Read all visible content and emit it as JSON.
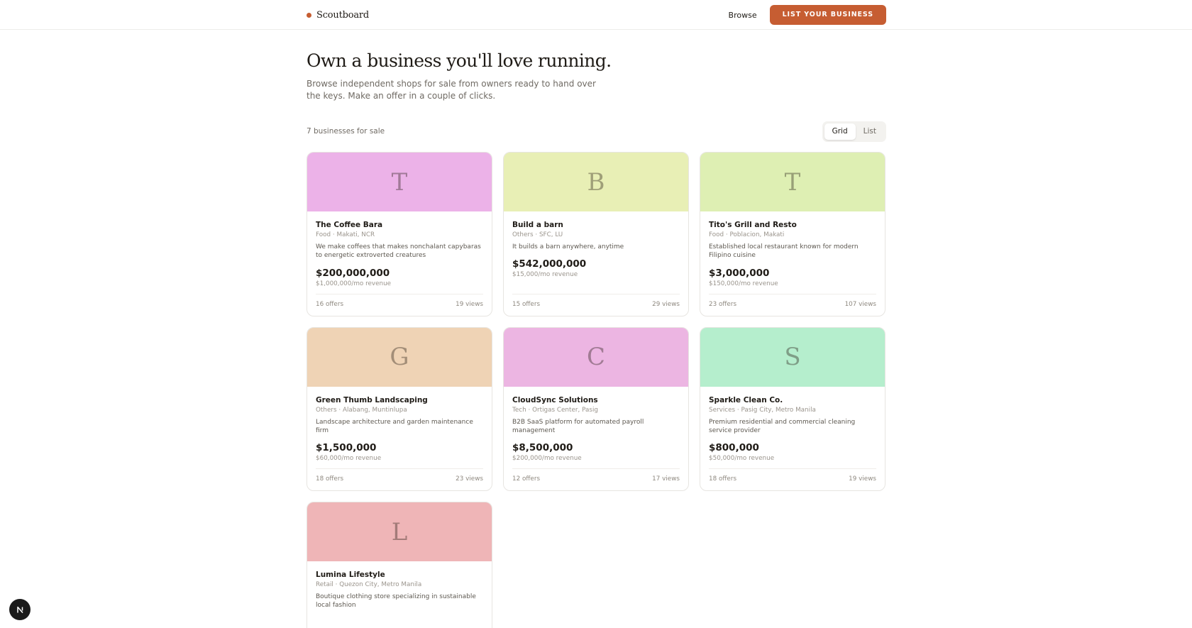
{
  "header": {
    "brand": "Scoutboard",
    "nav_browse": "Browse",
    "cta": "LIST YOUR BUSINESS"
  },
  "hero": {
    "title": "Own a business you'll love running.",
    "subtitle": "Browse independent shops for sale from owners ready to hand over the keys. Make an offer in a couple of clicks."
  },
  "listing": {
    "count_label": "7 businesses for sale",
    "view_toggle": [
      "Grid",
      "List"
    ],
    "active_view": "Grid"
  },
  "businesses": [
    {
      "initial": "T",
      "name": "The Coffee Bara",
      "meta": "Food · Makati, NCR",
      "desc": "We make coffees that makes nonchalant capybaras to energetic extroverted creatures",
      "price": "$200,000,000",
      "revenue": "$1,000,000/mo revenue",
      "offers": "16 offers",
      "views": "19 views",
      "color": "#ecb2e8"
    },
    {
      "initial": "B",
      "name": "Build a barn",
      "meta": "Others · SFC, LU",
      "desc": "It builds a barn anywhere, anytime",
      "price": "$542,000,000",
      "revenue": "$15,000/mo revenue",
      "offers": "15 offers",
      "views": "29 views",
      "color": "#e8efb5"
    },
    {
      "initial": "T",
      "name": "Tito's Grill and Resto",
      "meta": "Food · Poblacion, Makati",
      "desc": "Established local restaurant known for modern Filipino cuisine",
      "price": "$3,000,000",
      "revenue": "$150,000/mo revenue",
      "offers": "23 offers",
      "views": "107 views",
      "color": "#deefb3"
    },
    {
      "initial": "G",
      "name": "Green Thumb Landscaping",
      "meta": "Others · Alabang, Muntinlupa",
      "desc": "Landscape architecture and garden maintenance firm",
      "price": "$1,500,000",
      "revenue": "$60,000/mo revenue",
      "offers": "18 offers",
      "views": "23 views",
      "color": "#efd3b5"
    },
    {
      "initial": "C",
      "name": "CloudSync Solutions",
      "meta": "Tech · Ortigas Center, Pasig",
      "desc": "B2B SaaS platform for automated payroll management",
      "price": "$8,500,000",
      "revenue": "$200,000/mo revenue",
      "offers": "12 offers",
      "views": "17 views",
      "color": "#ecb5e2"
    },
    {
      "initial": "S",
      "name": "Sparkle Clean Co.",
      "meta": "Services · Pasig City, Metro Manila",
      "desc": "Premium residential and commercial cleaning service provider",
      "price": "$800,000",
      "revenue": "$50,000/mo revenue",
      "offers": "18 offers",
      "views": "19 views",
      "color": "#b5eecd"
    },
    {
      "initial": "L",
      "name": "Lumina Lifestyle",
      "meta": "Retail · Quezon City, Metro Manila",
      "desc": "Boutique clothing store specializing in sustainable local fashion",
      "price": "",
      "revenue": "",
      "offers": "",
      "views": "",
      "color": "#efb5b7"
    }
  ],
  "colors": {
    "accent": "#c65d32"
  },
  "icons": {
    "dev_badge": "nextjs-icon"
  }
}
